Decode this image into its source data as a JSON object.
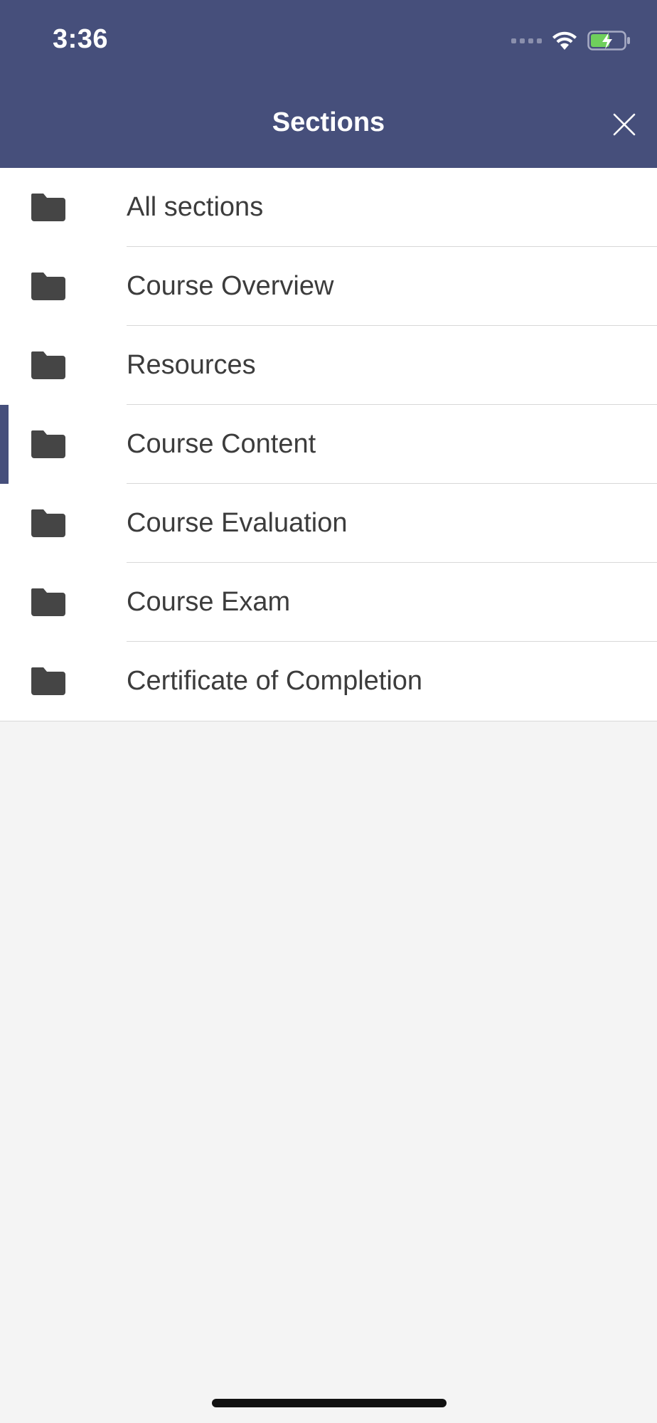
{
  "status_bar": {
    "time": "3:36",
    "icons": [
      "signal-dots-icon",
      "wifi-icon",
      "battery-charging-icon"
    ],
    "battery_color": "#6fcf5c"
  },
  "header": {
    "title": "Sections",
    "close_icon": "close-icon",
    "background": "#464f7b"
  },
  "sections": [
    {
      "label": "All sections",
      "icon": "folder-icon",
      "active": false
    },
    {
      "label": "Course Overview",
      "icon": "folder-icon",
      "active": false
    },
    {
      "label": "Resources",
      "icon": "folder-icon",
      "active": false
    },
    {
      "label": "Course Content",
      "icon": "folder-icon",
      "active": true
    },
    {
      "label": "Course Evaluation",
      "icon": "folder-icon",
      "active": false
    },
    {
      "label": "Course Exam",
      "icon": "folder-icon",
      "active": false
    },
    {
      "label": "Certificate of Completion",
      "icon": "folder-icon",
      "active": false
    }
  ],
  "colors": {
    "accent": "#464f7b",
    "folder": "#454545",
    "text": "#3c3c3c",
    "background": "#f4f4f4"
  }
}
